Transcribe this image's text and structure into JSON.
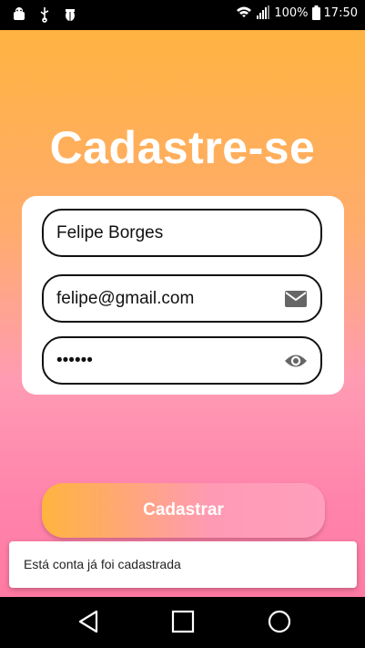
{
  "status_bar": {
    "left_icons": [
      "android-icon",
      "usb-icon",
      "bug-icon"
    ],
    "right_icons": [
      "wifi-icon",
      "signal-icon",
      "battery-icon"
    ],
    "battery_text": "100%",
    "time": "17:50"
  },
  "screen": {
    "title": "Cadastre-se"
  },
  "form": {
    "name_value": "Felipe Borges",
    "email_value": "felipe@gmail.com",
    "email_icon": "mail-icon",
    "password_value": "••••••",
    "password_icon": "eye-icon"
  },
  "submit": {
    "label": "Cadastrar"
  },
  "toast": {
    "message": "Está conta já foi cadastrada"
  },
  "nav": {
    "icons": [
      "back-icon",
      "home-icon",
      "recent-apps-icon"
    ]
  },
  "colors": {
    "gradient_top": "#ffb341",
    "gradient_bottom": "#ff7aa3",
    "button_start": "#ffb43e",
    "button_end": "#ff9fbd"
  }
}
